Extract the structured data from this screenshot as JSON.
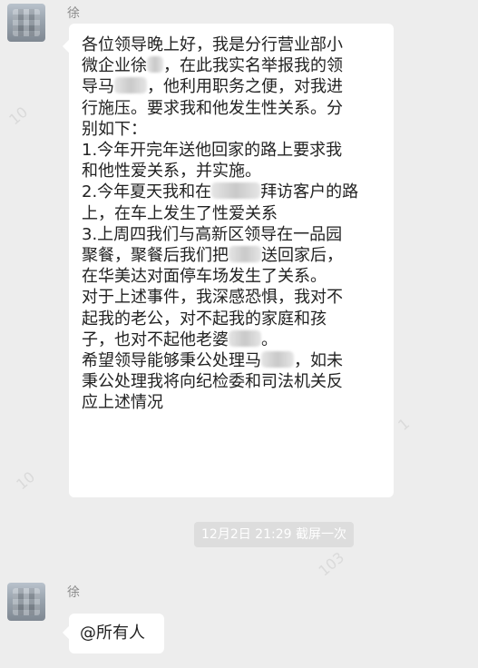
{
  "chat": {
    "sender_name": "徐",
    "timestamp": "12月2日 21:29 截屏一次",
    "messages": [
      {
        "lines": [
          {
            "segments": [
              {
                "text": "各位领导晚上好，我是分行营业部小"
              }
            ]
          },
          {
            "segments": [
              {
                "text": "微企业徐"
              },
              {
                "blur": 1
              },
              {
                "text": "，在此我实名举报我的领"
              }
            ]
          },
          {
            "segments": [
              {
                "text": "导马"
              },
              {
                "blur": 2
              },
              {
                "text": "，他利用职务之便，对我进"
              }
            ]
          },
          {
            "segments": [
              {
                "text": "行施压。要求我和他发生性关系。分"
              }
            ]
          },
          {
            "segments": [
              {
                "text": "别如下："
              }
            ]
          },
          {
            "segments": [
              {
                "text": "1.今年开完年送他回家的路上要求我"
              }
            ]
          },
          {
            "segments": [
              {
                "text": "和他性爱关系，并实施。"
              }
            ]
          },
          {
            "segments": [
              {
                "text": "2.今年夏天我和在"
              },
              {
                "blur": 3
              },
              {
                "text": "拜访客户的路"
              }
            ]
          },
          {
            "segments": [
              {
                "text": "上，在车上发生了性爱关系"
              }
            ]
          },
          {
            "segments": [
              {
                "text": "3.上周四我们与高新区领导在一品园"
              }
            ]
          },
          {
            "segments": [
              {
                "text": "聚餐，聚餐后我们把"
              },
              {
                "blur": 2
              },
              {
                "text": "送回家后，"
              }
            ]
          },
          {
            "segments": [
              {
                "text": "在华美达对面停车场发生了关系。"
              }
            ]
          },
          {
            "segments": [
              {
                "text": "对于上述事件，我深感恐惧，我对不"
              }
            ]
          },
          {
            "segments": [
              {
                "text": "起我的老公，对不起我的家庭和孩"
              }
            ]
          },
          {
            "segments": [
              {
                "text": "子，也对不起他老婆"
              },
              {
                "blur": 2
              },
              {
                "text": "。"
              }
            ]
          },
          {
            "segments": [
              {
                "text": "希望领导能够秉公处理马"
              },
              {
                "blur": 2
              },
              {
                "text": "，如未"
              }
            ]
          },
          {
            "segments": [
              {
                "text": "秉公处理我将向纪检委和司法机关反"
              }
            ]
          },
          {
            "segments": [
              {
                "text": "应上述情况"
              }
            ]
          }
        ]
      },
      {
        "lines": [
          {
            "segments": [
              {
                "text": "@所有人"
              }
            ]
          }
        ]
      }
    ]
  }
}
